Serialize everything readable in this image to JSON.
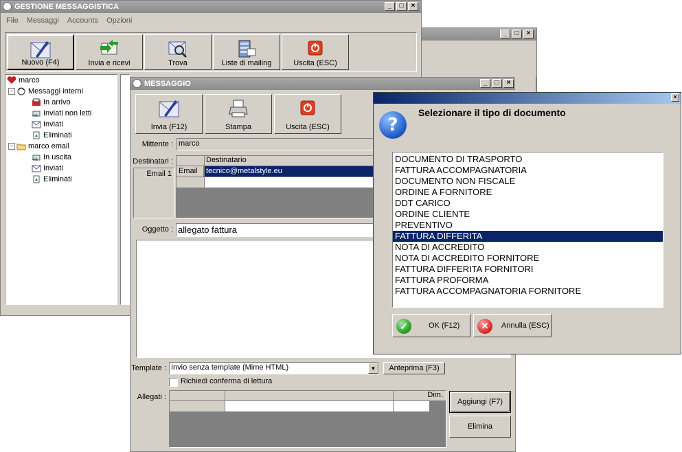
{
  "main_window": {
    "title": "GESTIONE MESSAGGISTICA",
    "menu": [
      "File",
      "Messaggi",
      "Accounts",
      "Opzioni"
    ],
    "toolbar": [
      "Nuovo (F4)",
      "Invia e ricevi",
      "Trova",
      "Liste di mailing",
      "Uscita (ESC)"
    ],
    "tree": {
      "root": "marco",
      "internal_folder": "Messaggi interni",
      "internal_items": [
        "In arrivo",
        "Inviati non letti",
        "Inviati",
        "Eliminati"
      ],
      "email_folder": "marco email",
      "email_items": [
        "In uscita",
        "Inviati",
        "Eliminati"
      ]
    }
  },
  "message_window": {
    "title": "MESSAGGIO",
    "toolbar": [
      "Invia (F12)",
      "Stampa",
      "Uscita (ESC)"
    ],
    "sender_label": "Mittente :",
    "sender_value": "marco",
    "recipients_label": "Destinatari :",
    "recipient_row_label": "Email 1",
    "grid_header": "Destinatario",
    "grid_type": "Email",
    "grid_value": "tecnico@metalstyle.eu",
    "subject_label": "Oggetto :",
    "subject_value": "allegato fattura",
    "template_label": "Template :",
    "template_value": "Invio senza template (Mime HTML)",
    "preview_button": "Anteprima (F3)",
    "read_receipt_label": "Richiedi conferma di lettura",
    "attachments_label": "Allegati :",
    "attach_header_dim": "Dim.",
    "add_button": "Aggiungi (F7)",
    "delete_button": "Elimina"
  },
  "dialog": {
    "heading": "Selezionare il tipo di documento",
    "options": [
      "DOCUMENTO DI TRASPORTO",
      "FATTURA ACCOMPAGNATORIA",
      "DOCUMENTO NON FISCALE",
      "ORDINE A FORNITORE",
      "DDT CARICO",
      "ORDINE CLIENTE",
      "PREVENTIVO",
      "FATTURA DIFFERITA",
      "NOTA DI ACCREDITO",
      "NOTA DI ACCREDITO FORNITORE",
      "FATTURA DIFFERITA FORNITORI",
      "FATTURA PROFORMA",
      "FATTURA ACCOMPAGNATORIA FORNITORE"
    ],
    "selected": "FATTURA DIFFERITA",
    "ok_button": "OK (F12)",
    "cancel_button": "Annulla (ESC)"
  },
  "colors": {
    "face": "#d4d0c8",
    "selection": "#0a246a",
    "title_inactive": "#8c8c8c",
    "title_active": "#0a246a"
  }
}
